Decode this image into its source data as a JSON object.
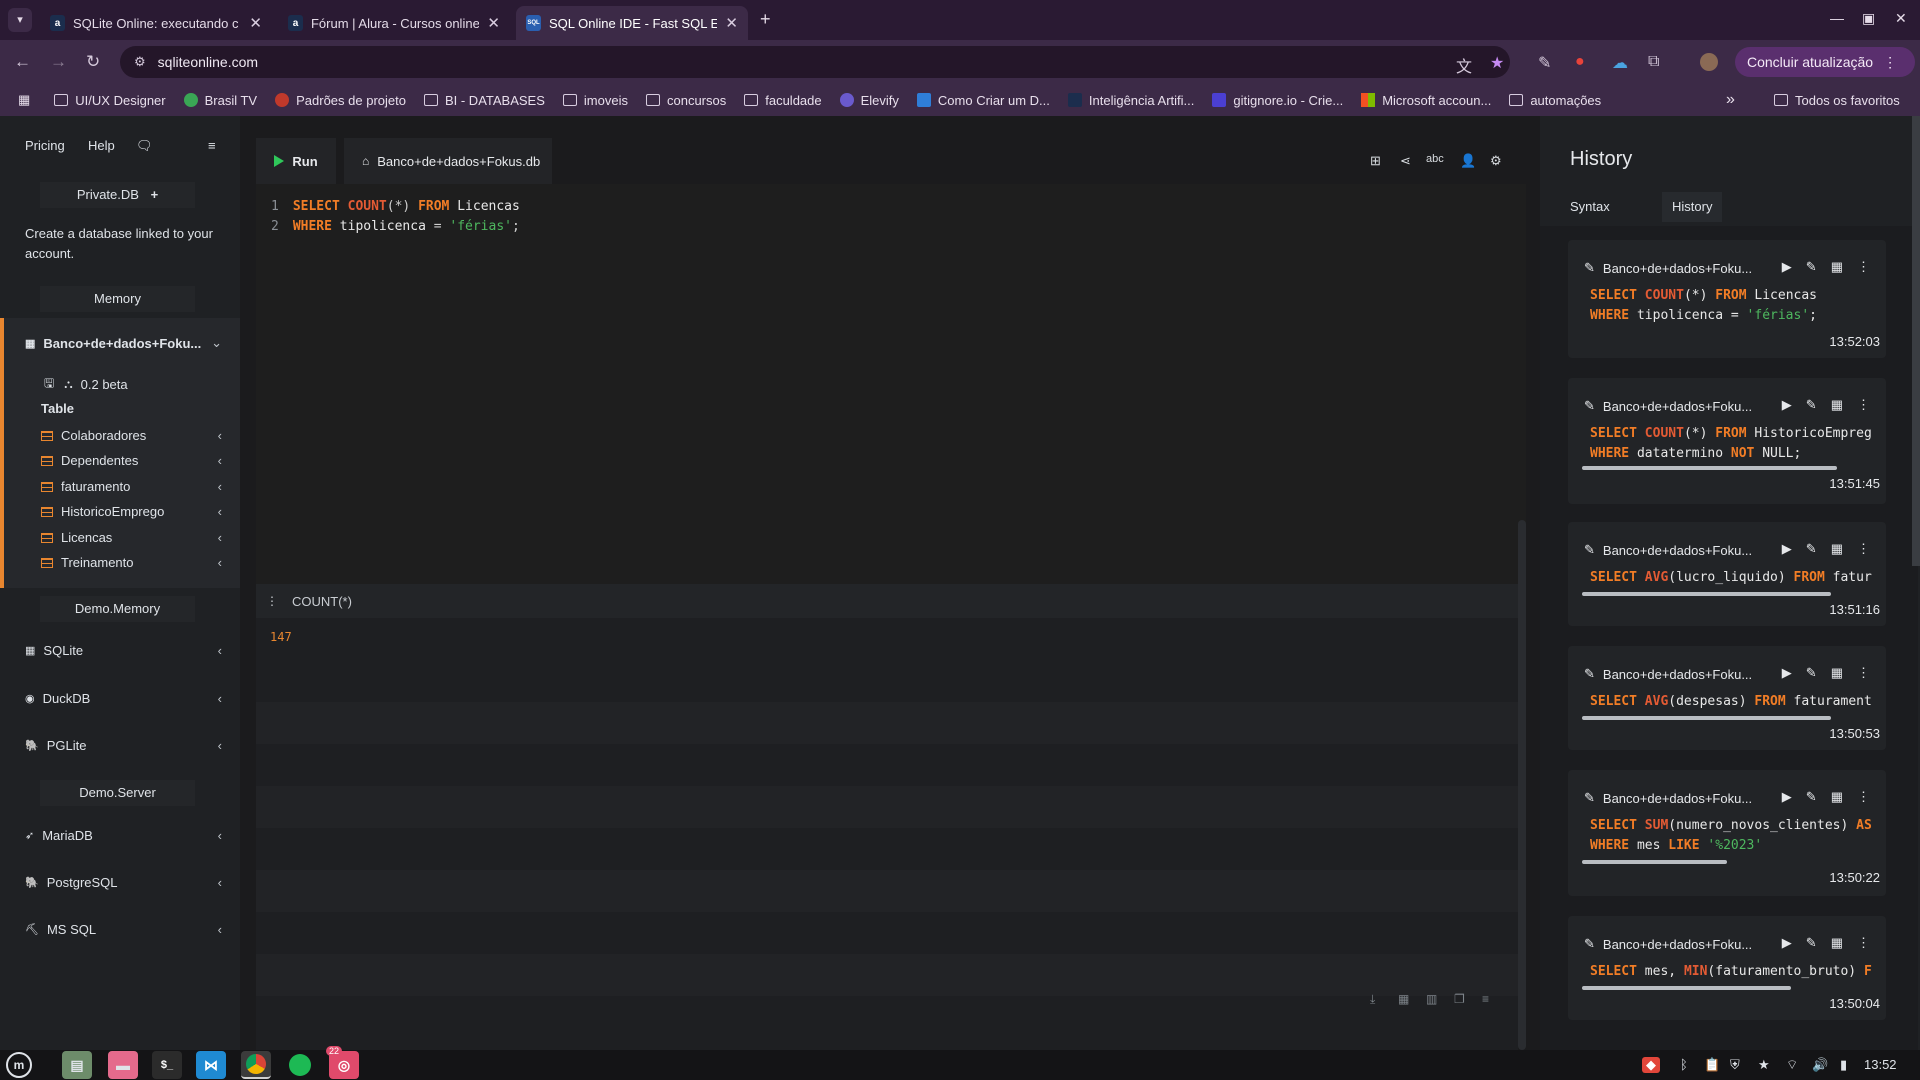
{
  "browser": {
    "tabs": [
      {
        "title": "SQLite Online: executando c",
        "favicon": "a"
      },
      {
        "title": "Fórum | Alura - Cursos online",
        "favicon": "a"
      },
      {
        "title": "SQL Online IDE - Fast SQL Ed",
        "favicon": "SQL"
      }
    ],
    "url": "sqliteonline.com",
    "update_button": "Concluir atualização",
    "bookmarks": [
      "UI/UX Designer",
      "Brasil TV",
      "Padrões de projeto",
      "BI - DATABASES",
      "imoveis",
      "concursos",
      "faculdade",
      "Elevify",
      "Como Criar um D...",
      "Inteligência Artifi...",
      "gitignore.io - Crie...",
      "Microsoft accoun...",
      "automações"
    ],
    "bookmarks_more": "»",
    "all_bookmarks": "Todos os favoritos"
  },
  "sidebar": {
    "nav": {
      "pricing": "Pricing",
      "help": "Help"
    },
    "private_db": "Private.DB",
    "private_db_text": "Create a database linked to your account.",
    "memory": "Memory",
    "current_db": "Banco+de+dados+Foku...",
    "version": "0.2 beta",
    "table_label": "Table",
    "tables": [
      "Colaboradores",
      "Dependentes",
      "faturamento",
      "HistoricoEmprego",
      "Licencas",
      "Treinamento"
    ],
    "demo_memory": "Demo.Memory",
    "memory_engines": [
      "SQLite",
      "DuckDB",
      "PGLite"
    ],
    "demo_server": "Demo.Server",
    "server_engines": [
      "MariaDB",
      "PostgreSQL",
      "MS SQL"
    ]
  },
  "editor": {
    "run_label": "Run",
    "db_tab": "Banco+de+dados+Fokus.db",
    "line_numbers": [
      "1",
      "2"
    ],
    "query": {
      "l1_select": "SELECT",
      "l1_count": "COUNT",
      "l1_star": "(*)",
      "l1_from": "FROM",
      "l1_table": "Licencas",
      "l2_where": "WHERE",
      "l2_col": "tipolicenca",
      "l2_eq": "=",
      "l2_str": "'férias'",
      "l2_semi": ";"
    }
  },
  "results": {
    "column": "COUNT(*)",
    "value": "147"
  },
  "history": {
    "title": "History",
    "tabs": [
      "Syntax",
      "History"
    ],
    "entries": [
      {
        "db": "Banco+de+dados+Foku...",
        "line1": "SELECT COUNT(*) FROM Licencas",
        "line2": "WHERE tipolicenca = 'férias';",
        "time": "13:52:03",
        "progress": 0
      },
      {
        "db": "Banco+de+dados+Foku...",
        "line1": "SELECT COUNT(*) FROM HistoricoEmpreg",
        "line2": "WHERE datatermino NOT NULL;",
        "time": "13:51:45",
        "progress": 0.88
      },
      {
        "db": "Banco+de+dados+Foku...",
        "line1": "SELECT AVG(lucro_liquido) FROM fatur",
        "line2": "",
        "time": "13:51:16",
        "progress": 0.86
      },
      {
        "db": "Banco+de+dados+Foku...",
        "line1": "SELECT AVG(despesas) FROM faturament",
        "line2": "",
        "time": "13:50:53",
        "progress": 0.86
      },
      {
        "db": "Banco+de+dados+Foku...",
        "line1": "SELECT SUM(numero_novos_clientes) AS",
        "line2": "WHERE mes LIKE '%2023'",
        "time": "13:50:22",
        "progress": 0.5
      },
      {
        "db": "Banco+de+dados+Foku...",
        "line1": "SELECT mes, MIN(faturamento_bruto) F",
        "line2": "",
        "time": "13:50:04",
        "progress": 0.72
      }
    ]
  },
  "taskbar": {
    "badge": "22",
    "clock": "13:52"
  },
  "colors": {
    "accent": "#e8862f",
    "run": "#2fc75a",
    "keyword": "#f27d26",
    "string": "#4eb85f"
  }
}
